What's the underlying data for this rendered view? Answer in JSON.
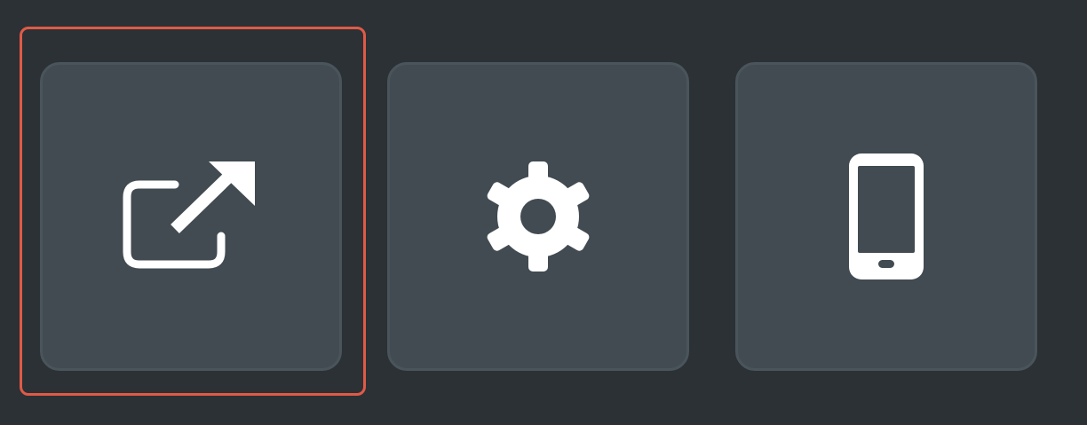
{
  "colors": {
    "background": "#2b3135",
    "tile_fill": "#414b51",
    "tile_border": "#4a555b",
    "icon": "#ffffff",
    "focus_ring": "#e05a47"
  },
  "toolbar": {
    "buttons": [
      {
        "icon": "external-link-icon",
        "selected": true
      },
      {
        "icon": "gear-icon",
        "selected": false
      },
      {
        "icon": "smartphone-icon",
        "selected": false
      }
    ]
  }
}
